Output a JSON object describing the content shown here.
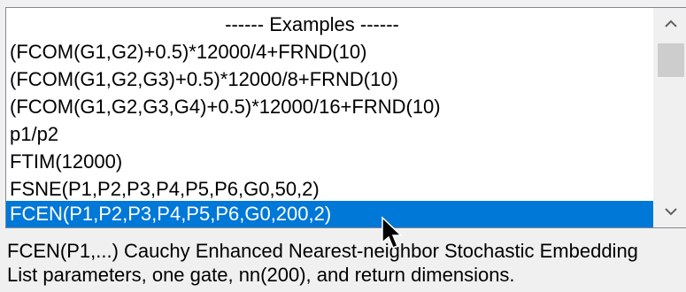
{
  "list": {
    "items": [
      {
        "label": "------ Examples ------",
        "header": true
      },
      {
        "label": "(FCOM(G1,G2)+0.5)*12000/4+FRND(10)"
      },
      {
        "label": "(FCOM(G1,G2,G3)+0.5)*12000/8+FRND(10)"
      },
      {
        "label": "(FCOM(G1,G2,G3,G4)+0.5)*12000/16+FRND(10)"
      },
      {
        "label": "p1/p2"
      },
      {
        "label": "FTIM(12000)"
      },
      {
        "label": "FSNE(P1,P2,P3,P4,P5,P6,G0,50,2)"
      },
      {
        "label": "FCEN(P1,P2,P3,P4,P5,P6,G0,200,2)",
        "selected": true
      }
    ],
    "scroll_up_icon": "chevron-up-icon",
    "scroll_down_icon": "chevron-down-icon"
  },
  "description": {
    "line1": "FCEN(P1,...) Cauchy Enhanced Nearest-neighbor Stochastic Embedding",
    "line2": "List parameters, one gate, nn(200), and return dimensions."
  },
  "colors": {
    "selection": "#0078d7",
    "background": "#f0f0f0"
  },
  "cursor_icon": "mouse-pointer-icon"
}
